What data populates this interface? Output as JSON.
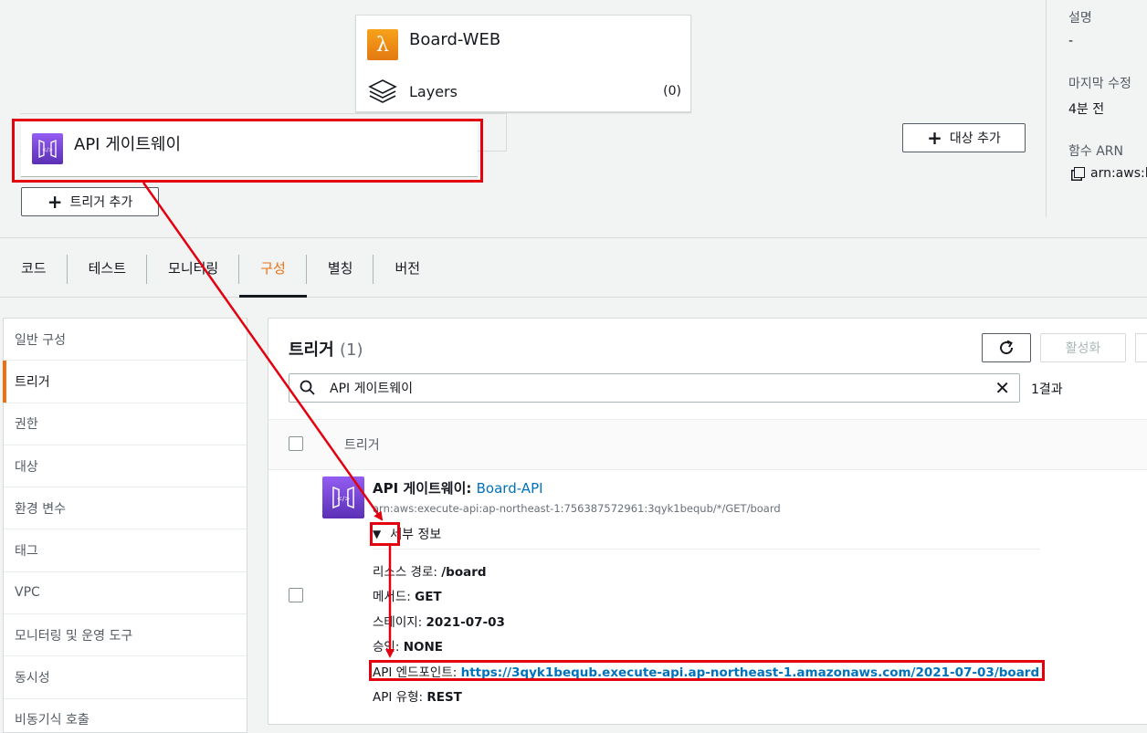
{
  "designer": {
    "function_name": "Board-WEB",
    "layers_label": "Layers",
    "layers_count": "(0)",
    "trigger_name": "API 게이트웨이",
    "add_trigger_label": "트리거 추가",
    "add_destination_label": "대상 추가"
  },
  "side_info": {
    "description_label": "설명",
    "description_value": "-",
    "last_modified_label": "마지막 수정",
    "last_modified_value": "4분 전",
    "arn_label": "함수 ARN",
    "arn_value": "arn:aws:l"
  },
  "tabs": [
    "코드",
    "테스트",
    "모니터링",
    "구성",
    "별칭",
    "버전"
  ],
  "active_tab": "구성",
  "left_nav": [
    "일반 구성",
    "트리거",
    "권한",
    "대상",
    "환경 변수",
    "태그",
    "VPC",
    "모니터링 및 운영 도구",
    "동시성",
    "비동기식 호출"
  ],
  "active_nav": "트리거",
  "main": {
    "title": "트리거",
    "count": "(1)",
    "activate_label": "활성화",
    "search_value": "API 게이트웨이",
    "result_count": "1결과",
    "column_header": "트리거",
    "trigger": {
      "type": "API 게이트웨이: ",
      "name": "Board-API",
      "arn": "arn:aws:execute-api:ap-northeast-1:756387572961:3qyk1bequb/*/GET/board",
      "details_label": "세부 정보",
      "resource_path_label": "리소스 경로: ",
      "resource_path": "/board",
      "method_label": "메서드: ",
      "method": "GET",
      "stage_label": "스테이지: ",
      "stage": "2021-07-03",
      "auth_label": "승인: ",
      "auth": "NONE",
      "endpoint_label": "API 엔드포인트: ",
      "endpoint": "https://3qyk1bequb.execute-api.ap-northeast-1.amazonaws.com/2021-07-03/board",
      "api_type_label": "API 유형: ",
      "api_type": "REST"
    }
  },
  "colors": {
    "accent": "#ec7211",
    "link": "#0073bb",
    "annotation": "#e3000f"
  }
}
